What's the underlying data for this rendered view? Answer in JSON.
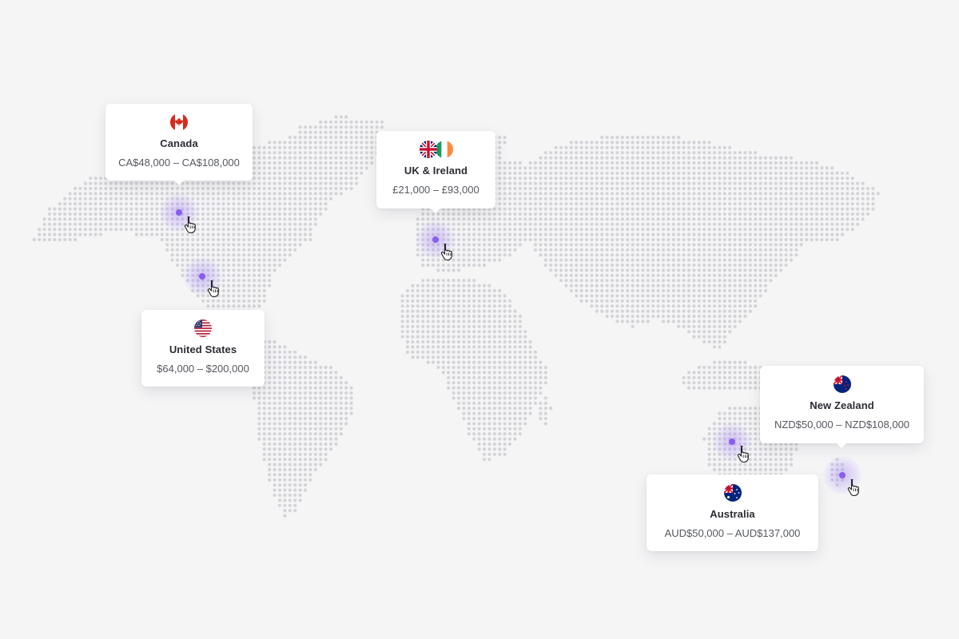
{
  "regions": {
    "canada": {
      "country": "Canada",
      "range": "CA$48,000 – CA$108,000",
      "flag": "canada-flag",
      "color": "#d52b1e"
    },
    "united_states": {
      "country": "United States",
      "range": "$64,000 – $200,000",
      "flag": "usa-flag",
      "color": "#b22234"
    },
    "uk_ireland": {
      "country": "UK & Ireland",
      "range": "£21,000 – £93,000",
      "flag": "uk-ireland-flags",
      "color": "#012169"
    },
    "new_zealand": {
      "country": "New Zealand",
      "range": "NZD$50,000 – NZD$108,000",
      "flag": "new-zealand-flag",
      "color": "#00247d"
    },
    "australia": {
      "country": "Australia",
      "range": "AUD$50,000 – AUD$137,000",
      "flag": "australia-flag",
      "color": "#00247d"
    }
  },
  "colors": {
    "pin": "#8a5cf0",
    "dots": "#d3d4d8",
    "background": "#f5f5f6"
  }
}
